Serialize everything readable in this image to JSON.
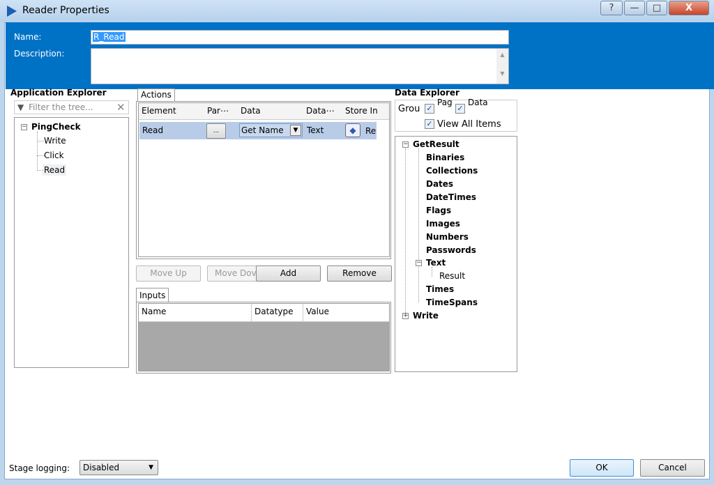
{
  "window": {
    "title": "Reader Properties",
    "help": "?",
    "minimize": "—",
    "maximize": "□",
    "close": "X"
  },
  "header": {
    "name_label": "Name:",
    "name_value": "R_Read",
    "description_label": "Description:",
    "description_value": ""
  },
  "app_explorer": {
    "title": "Application Explorer",
    "filter_placeholder": "Filter the tree...",
    "root": "PingCheck",
    "children": [
      "Write",
      "Click",
      "Read"
    ],
    "selected": "Read"
  },
  "actions": {
    "tab": "Actions",
    "columns": [
      "Element",
      "Par⋯",
      "Data",
      "Data⋯",
      "Store In"
    ],
    "rows": [
      {
        "element": "Read",
        "params": "...",
        "data": "Get Name",
        "datatype": "Text",
        "store_in": "Re"
      }
    ],
    "buttons": {
      "move_up": "Move Up",
      "move_down": "Move Dov",
      "add": "Add",
      "remove": "Remove"
    }
  },
  "inputs": {
    "tab": "Inputs",
    "columns": [
      "Name",
      "Datatype",
      "Value"
    ]
  },
  "data_explorer": {
    "title": "Data Explorer",
    "group_label": "Grou",
    "check_page": "Pag",
    "check_datatype": "Data",
    "check_view_all": "View All Items",
    "tree": {
      "root": "GetResult",
      "children": [
        "Binaries",
        "Collections",
        "Dates",
        "DateTimes",
        "Flags",
        "Images",
        "Numbers",
        "Passwords",
        "Text",
        "Times",
        "TimeSpans"
      ],
      "text_children": [
        "Result"
      ],
      "root2": "Write"
    }
  },
  "footer": {
    "stage_logging_label": "Stage logging:",
    "stage_logging_value": "Disabled",
    "ok": "OK",
    "cancel": "Cancel"
  },
  "colors": {
    "accent": "#0072c6",
    "selection": "#b8cce8"
  }
}
